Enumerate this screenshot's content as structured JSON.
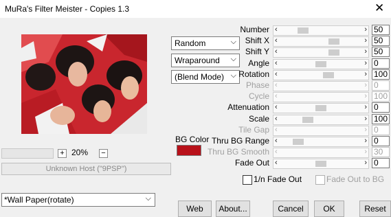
{
  "window": {
    "title": "MuRa's Filter Meister - Copies 1.3",
    "close_glyph": "✕"
  },
  "zoom": {
    "plus": "+",
    "minus": "−",
    "percent": "20%"
  },
  "status": {
    "host_text": "Unknown Host (\"9PSP\")"
  },
  "selects": {
    "mode": "Random",
    "edge": "Wraparound",
    "blend": "(Blend Mode)"
  },
  "bgcolor": {
    "label": "BG Color",
    "color": "#b8111a"
  },
  "params": [
    {
      "label": "Number",
      "value": "50",
      "enabled": true,
      "level": 0.22
    },
    {
      "label": "Shift X",
      "value": "50",
      "enabled": true,
      "level": 0.7
    },
    {
      "label": "Shift Y",
      "value": "50",
      "enabled": true,
      "level": 0.7
    },
    {
      "label": "Angle",
      "value": "0",
      "enabled": true,
      "level": 0.5
    },
    {
      "label": "Rotation",
      "value": "100",
      "enabled": true,
      "level": 0.62
    },
    {
      "label": "Phase",
      "value": "0",
      "enabled": false,
      "level": 0.0
    },
    {
      "label": "Cycle",
      "value": "100",
      "enabled": false,
      "level": 0.0
    },
    {
      "label": "Attenuation",
      "value": "0",
      "enabled": true,
      "level": 0.5
    },
    {
      "label": "Scale",
      "value": "100",
      "enabled": true,
      "level": 0.3
    },
    {
      "label": "Tile Gap",
      "value": "0",
      "enabled": false,
      "level": 0.0
    },
    {
      "label": "Thru BG Range",
      "value": "0",
      "enabled": true,
      "level": 0.15
    },
    {
      "label": "Thru BG Smooth",
      "value": "30",
      "enabled": false,
      "level": 0.0
    },
    {
      "label": "Fade Out",
      "value": "0",
      "enabled": true,
      "level": 0.5
    }
  ],
  "checks": {
    "inv_fade": "1/n Fade Out",
    "fade_to_bg": "Fade Out to BG"
  },
  "preset": {
    "value": "*Wall Paper(rotate)"
  },
  "buttons": {
    "web": "Web",
    "about": "About...",
    "cancel": "Cancel",
    "ok": "OK",
    "reset": "Reset"
  },
  "icons": {
    "arrow_left": "‹",
    "arrow_right": "›",
    "chevron_down": "⌵"
  }
}
